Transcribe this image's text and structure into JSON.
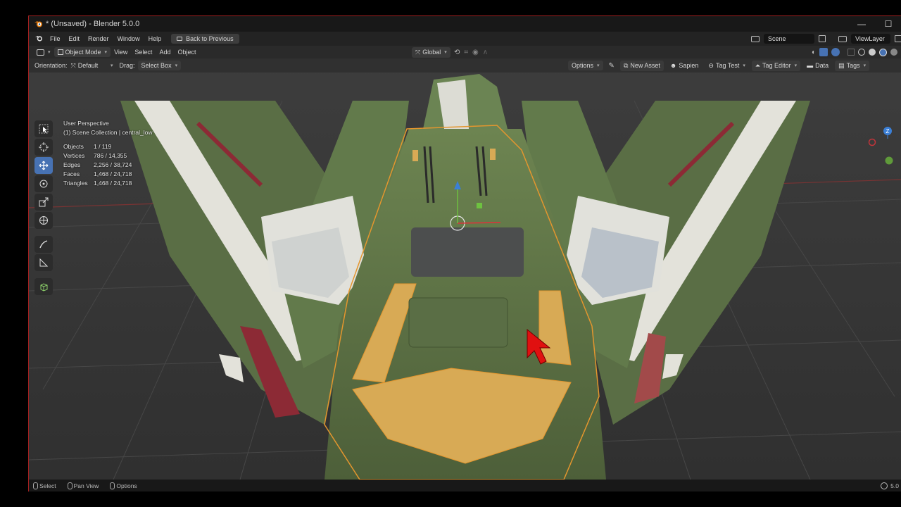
{
  "window": {
    "title": "* (Unsaved) - Blender 5.0.0",
    "min_glyph": "—",
    "max_glyph": "☐"
  },
  "menubar": {
    "items": [
      "File",
      "Edit",
      "Render",
      "Window",
      "Help"
    ],
    "back_label": "Back to Previous",
    "scene_value": "Scene",
    "viewlayer_value": "ViewLayer"
  },
  "header1": {
    "mode": "Object Mode",
    "menus": [
      "View",
      "Select",
      "Add",
      "Object"
    ],
    "transform_orientation": "Global"
  },
  "header2": {
    "orientation_label": "Orientation:",
    "orientation_value": "Default",
    "drag_label": "Drag:",
    "drag_value": "Select Box",
    "options_label": "Options",
    "new_asset": "New Asset",
    "sapien": "Sapien",
    "tag_test": "Tag Test",
    "tag_editor": "Tag Editor",
    "data": "Data",
    "tags": "Tags"
  },
  "viewport": {
    "perspective": "User Perspective",
    "collection": "(1) Scene Collection | central_low",
    "stats": [
      {
        "label": "Objects",
        "value": "1 / 119"
      },
      {
        "label": "Vertices",
        "value": "786 / 14,355"
      },
      {
        "label": "Edges",
        "value": "2,256 / 38,724"
      },
      {
        "label": "Faces",
        "value": "1,468 / 24,718"
      },
      {
        "label": "Triangles",
        "value": "1,468 / 24,718"
      }
    ],
    "gizmo_z": "Z"
  },
  "statusbar": {
    "select": "Select",
    "pan_view": "Pan View",
    "options": "Options",
    "version": "5.0"
  },
  "colors": {
    "accent": "#4772b3",
    "hull_green": "#5d7446",
    "hull_light": "#e3e2da",
    "selection_orange": "#e4962e",
    "cockpit_yellow": "#d8aa55",
    "stripe_red": "#8c2a35",
    "frame_border": "#a32020",
    "cursor_red": "#e01010"
  },
  "icons": [
    "blender-logo-icon",
    "select-box-icon",
    "cursor-icon",
    "move-icon",
    "rotate-icon",
    "scale-icon",
    "transform-icon",
    "annotate-icon",
    "measure-icon",
    "add-cube-icon",
    "mouse-icon",
    "globe-icon"
  ]
}
